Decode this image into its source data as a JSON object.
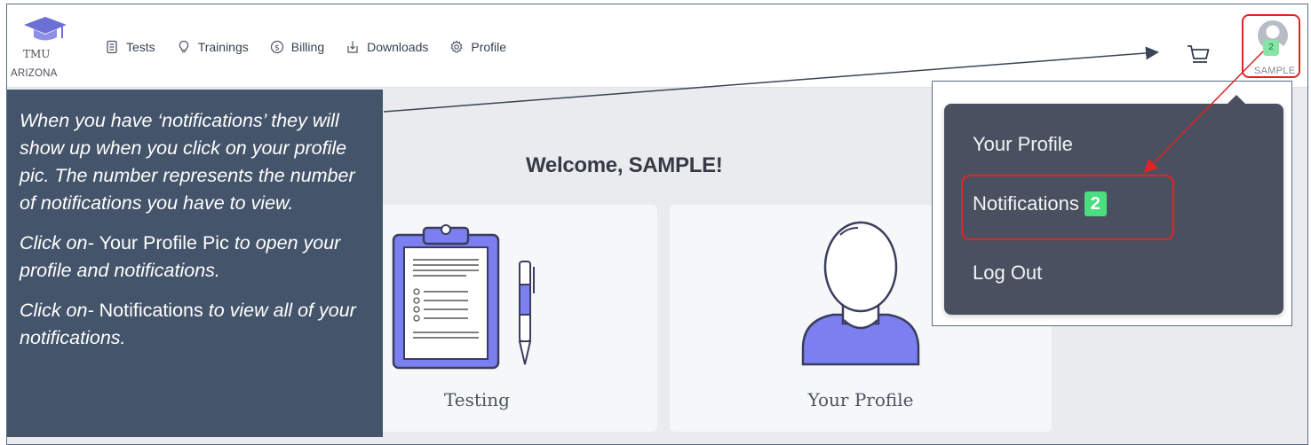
{
  "logo": {
    "title": "TMU",
    "subtitle": "ARIZONA"
  },
  "nav": {
    "items": [
      {
        "label": "Tests",
        "icon": "document-icon"
      },
      {
        "label": "Trainings",
        "icon": "lightbulb-icon"
      },
      {
        "label": "Billing",
        "icon": "dollar-circle-icon"
      },
      {
        "label": "Downloads",
        "icon": "download-icon"
      },
      {
        "label": "Profile",
        "icon": "gear-icon"
      }
    ]
  },
  "user": {
    "name": "SAMPLE",
    "badge_count": "2"
  },
  "main": {
    "welcome": "Welcome, SAMPLE!",
    "cards": [
      {
        "label": "Testing",
        "icon": "clipboard-icon"
      },
      {
        "label": "Your Profile",
        "icon": "person-icon"
      }
    ]
  },
  "dropdown": {
    "items": [
      {
        "label": "Your Profile"
      },
      {
        "label": "Notifications",
        "badge": "2"
      },
      {
        "label": "Log Out"
      }
    ]
  },
  "callout": {
    "p1": "When you have ‘notifications’ they will show up when you click on your profile pic.  The number represents the number of notifications you have to view.",
    "p2_prefix": "Click on-",
    "p2_highlight": "Your Profile Pic",
    "p2_suffix": "to open your profile and notifications.",
    "p3_prefix": "Click on-",
    "p3_highlight": "Notifications",
    "p3_suffix": "to view all of your notifications."
  },
  "colors": {
    "callout_bg": "#44546a",
    "accent_purple": "#6b6fd6",
    "badge_green": "#4ade80",
    "annotation_red": "#e02424"
  }
}
